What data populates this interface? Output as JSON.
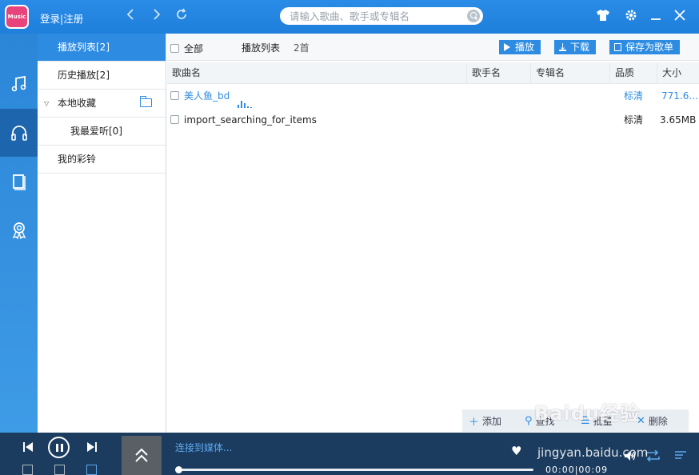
{
  "app": {
    "logo_text": "Music",
    "login": "登录",
    "separator": "|",
    "register": "注册",
    "search_placeholder": "请输入歌曲、歌手或专辑名",
    "search_value": ""
  },
  "sidebar": {
    "items": [
      {
        "label": "播放列表[2]",
        "active": true
      },
      {
        "label": "历史播放[2]"
      },
      {
        "label": "本地收藏",
        "expanded": true
      },
      {
        "label": "我最爱听[0]",
        "child": true
      },
      {
        "label": "我的彩铃"
      }
    ]
  },
  "toolbar": {
    "select_all": "全部",
    "list_label": "播放列表",
    "count": "2首",
    "play": "播放",
    "download": "下载",
    "save_as_list": "保存为歌单"
  },
  "table": {
    "columns": [
      "歌曲名",
      "歌手名",
      "专辑名",
      "品质",
      "大小"
    ],
    "rows": [
      {
        "name": "美人鱼_bd",
        "artist": "",
        "album": "",
        "quality": "标清",
        "size": "771.6...",
        "playing": true
      },
      {
        "name": "import_searching_for_items",
        "artist": "",
        "album": "",
        "quality": "标清",
        "size": "3.65MB",
        "playing": false
      }
    ]
  },
  "bottom_actions": {
    "add": "添加",
    "find": "查找",
    "batch": "批量",
    "delete": "删除"
  },
  "player": {
    "status": "连接到媒体...",
    "time": "00:00|00:09",
    "progress": 0
  },
  "watermark": {
    "brand": "Baidu经验",
    "url": "jingyan.baidu.com"
  },
  "colors": {
    "accent": "#2d8ce2",
    "titlebar": "#1f7fdc",
    "player_bg": "#1b3c5f"
  }
}
